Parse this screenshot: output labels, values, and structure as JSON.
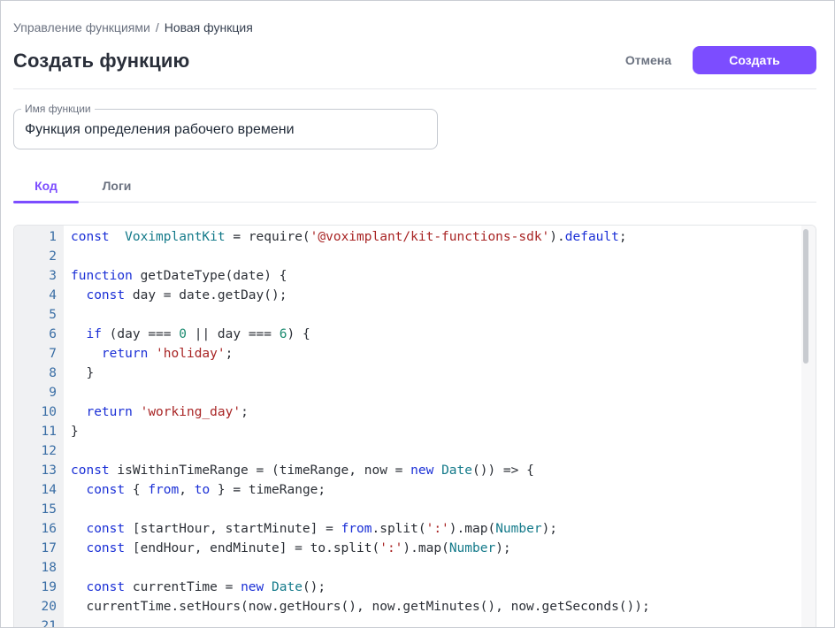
{
  "breadcrumb": {
    "parent": "Управление функциями",
    "separator": "/",
    "current": "Новая функция"
  },
  "header": {
    "title": "Создать функцию",
    "cancel_label": "Отмена",
    "create_label": "Создать"
  },
  "colors": {
    "accent": "#7c4dff",
    "keyword": "#1a2fd6",
    "string": "#a82424",
    "number": "#1a8a6f",
    "type": "#147a8a"
  },
  "form": {
    "name_label": "Имя функции",
    "name_value": "Функция определения рабочего времени"
  },
  "tabs": [
    {
      "label": "Код",
      "active": true
    },
    {
      "label": "Логи",
      "active": false
    }
  ],
  "editor": {
    "lines": [
      {
        "n": "1",
        "tokens": [
          [
            "k",
            "const"
          ],
          [
            "",
            "  "
          ],
          [
            "t",
            "VoximplantKit"
          ],
          [
            "",
            " = require("
          ],
          [
            "s",
            "'@voximplant/kit-functions-sdk'"
          ],
          [
            "",
            ")."
          ],
          [
            "k",
            "default"
          ],
          [
            "",
            ";"
          ]
        ]
      },
      {
        "n": "2",
        "tokens": []
      },
      {
        "n": "3",
        "tokens": [
          [
            "k",
            "function"
          ],
          [
            "",
            " getDateType(date) {"
          ]
        ]
      },
      {
        "n": "4",
        "tokens": [
          [
            "",
            "  "
          ],
          [
            "k",
            "const"
          ],
          [
            "",
            " day = date.getDay();"
          ]
        ]
      },
      {
        "n": "5",
        "tokens": []
      },
      {
        "n": "6",
        "tokens": [
          [
            "",
            "  "
          ],
          [
            "k",
            "if"
          ],
          [
            "",
            " (day === "
          ],
          [
            "n",
            "0"
          ],
          [
            "",
            " || day === "
          ],
          [
            "n",
            "6"
          ],
          [
            "",
            ") {"
          ]
        ]
      },
      {
        "n": "7",
        "tokens": [
          [
            "",
            "    "
          ],
          [
            "k",
            "return"
          ],
          [
            "",
            " "
          ],
          [
            "s",
            "'holiday'"
          ],
          [
            "",
            ";"
          ]
        ]
      },
      {
        "n": "8",
        "tokens": [
          [
            "",
            "  }"
          ]
        ]
      },
      {
        "n": "9",
        "tokens": []
      },
      {
        "n": "10",
        "tokens": [
          [
            "",
            "  "
          ],
          [
            "k",
            "return"
          ],
          [
            "",
            " "
          ],
          [
            "s",
            "'working_day'"
          ],
          [
            "",
            ";"
          ]
        ]
      },
      {
        "n": "11",
        "tokens": [
          [
            "",
            "}"
          ]
        ]
      },
      {
        "n": "12",
        "tokens": []
      },
      {
        "n": "13",
        "tokens": [
          [
            "k",
            "const"
          ],
          [
            "",
            " isWithinTimeRange = (timeRange, now = "
          ],
          [
            "k",
            "new"
          ],
          [
            "",
            " "
          ],
          [
            "t",
            "Date"
          ],
          [
            "",
            "()) => {"
          ]
        ]
      },
      {
        "n": "14",
        "tokens": [
          [
            "",
            "  "
          ],
          [
            "k",
            "const"
          ],
          [
            "",
            " { "
          ],
          [
            "k",
            "from"
          ],
          [
            "",
            ", "
          ],
          [
            "k",
            "to"
          ],
          [
            "",
            " } = timeRange;"
          ]
        ]
      },
      {
        "n": "15",
        "tokens": []
      },
      {
        "n": "16",
        "tokens": [
          [
            "",
            "  "
          ],
          [
            "k",
            "const"
          ],
          [
            "",
            " [startHour, startMinute] = "
          ],
          [
            "k",
            "from"
          ],
          [
            "",
            ".split("
          ],
          [
            "s",
            "':'"
          ],
          [
            "",
            ").map("
          ],
          [
            "t",
            "Number"
          ],
          [
            "",
            ");"
          ]
        ]
      },
      {
        "n": "17",
        "tokens": [
          [
            "",
            "  "
          ],
          [
            "k",
            "const"
          ],
          [
            "",
            " [endHour, endMinute] = to.split("
          ],
          [
            "s",
            "':'"
          ],
          [
            "",
            ").map("
          ],
          [
            "t",
            "Number"
          ],
          [
            "",
            ");"
          ]
        ]
      },
      {
        "n": "18",
        "tokens": []
      },
      {
        "n": "19",
        "tokens": [
          [
            "",
            "  "
          ],
          [
            "k",
            "const"
          ],
          [
            "",
            " currentTime = "
          ],
          [
            "k",
            "new"
          ],
          [
            "",
            " "
          ],
          [
            "t",
            "Date"
          ],
          [
            "",
            "();"
          ]
        ]
      },
      {
        "n": "20",
        "tokens": [
          [
            "",
            "  currentTime.setHours(now.getHours(), now.getMinutes(), now.getSeconds());"
          ]
        ]
      },
      {
        "n": "21",
        "tokens": []
      }
    ]
  }
}
